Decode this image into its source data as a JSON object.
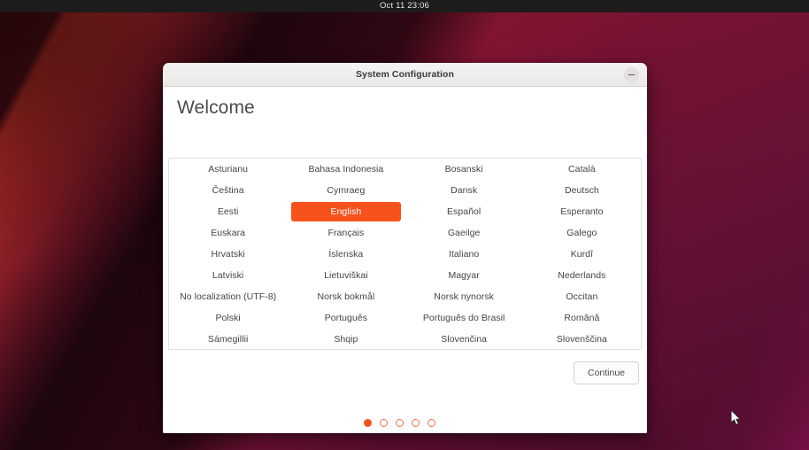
{
  "panel": {
    "clock": "Oct 11  23:06"
  },
  "window": {
    "title": "System Configuration",
    "minimize_label": "−"
  },
  "page": {
    "heading": "Welcome"
  },
  "languages": [
    "Asturianu",
    "Bahasa Indonesia",
    "Bosanski",
    "Català",
    "Čeština",
    "Cymraeg",
    "Dansk",
    "Deutsch",
    "Eesti",
    "English",
    "Español",
    "Esperanto",
    "Euskara",
    "Français",
    "Gaeilge",
    "Galego",
    "Hrvatski",
    "Íslenska",
    "Italiano",
    "Kurdî",
    "Latviski",
    "Lietuviškai",
    "Magyar",
    "Nederlands",
    "No localization (UTF-8)",
    "Norsk bokmål",
    "Norsk nynorsk",
    "Occitan",
    "Polski",
    "Português",
    "Português do Brasil",
    "Română",
    "Sámegillii",
    "Shqip",
    "Slovenčina",
    "Slovenščina"
  ],
  "selected_language": "English",
  "actions": {
    "continue_label": "Continue"
  },
  "pager": {
    "total": 5,
    "current_index": 0
  },
  "colors": {
    "accent": "#f7521c",
    "dot_outline": "#f2704a",
    "panel_bg": "#1d1b1b",
    "titlebar_bg": "#f0eeed"
  }
}
